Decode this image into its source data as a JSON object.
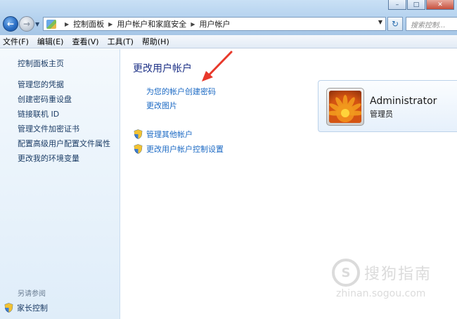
{
  "window": {
    "minimize_glyph": "–",
    "maximize_glyph": "□",
    "close_glyph": "✕"
  },
  "navigation": {
    "back_glyph": "←",
    "forward_glyph": "→",
    "history_glyph": "▼"
  },
  "address_bar": {
    "segments": [
      "控制面板",
      "用户帐户和家庭安全",
      "用户帐户"
    ],
    "refresh_glyph": "↻"
  },
  "search": {
    "placeholder": "搜索控制..."
  },
  "menu": [
    "文件(F)",
    "编辑(E)",
    "查看(V)",
    "工具(T)",
    "帮助(H)"
  ],
  "sidebar": {
    "home": "控制面板主页",
    "links": [
      "管理您的凭据",
      "创建密码重设盘",
      "链接联机 ID",
      "管理文件加密证书",
      "配置高级用户配置文件属性",
      "更改我的环境变量"
    ],
    "see_also_caption": "另请参阅",
    "parental_controls": "家长控制"
  },
  "main": {
    "title": "更改用户帐户",
    "links": [
      "为您的帐户创建密码",
      "更改图片"
    ],
    "admin_links": [
      "管理其他帐户",
      "更改用户帐户控制设置"
    ]
  },
  "account": {
    "name": "Administrator",
    "role": "管理员"
  },
  "watermark": {
    "cn": "搜狗指南",
    "en": "zhinan.sogou.com"
  },
  "colors": {
    "annotation_arrow": "#e8392b",
    "link": "#1c6ac4",
    "title": "#1e3287"
  }
}
